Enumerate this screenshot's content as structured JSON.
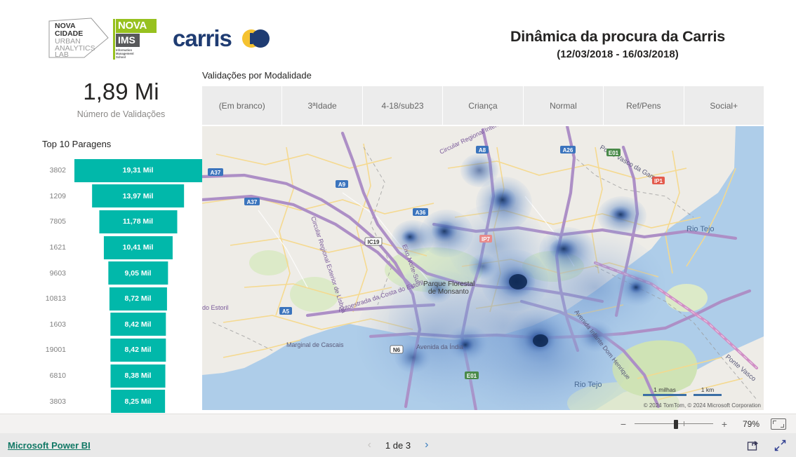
{
  "header": {
    "title": "Dinâmica da procura da Carris",
    "subtitle": "(12/03/2018 - 16/03/2018)",
    "logos": {
      "nova_cidade": [
        "NOVA",
        "CIDADE",
        "URBAN",
        "ANALYTICS",
        "LAB"
      ],
      "nova_ims_top": "NOVA",
      "nova_ims_mid": "IMS",
      "nova_ims_sub": [
        "Information",
        "Management",
        "School"
      ],
      "carris_word": "carris"
    }
  },
  "kpi": {
    "value": "1,89 Mi",
    "label": "Número de Validações"
  },
  "slicer": {
    "title": "Validações por Modalidade",
    "items": [
      {
        "label": "(Em branco)"
      },
      {
        "label": "3ªIdade"
      },
      {
        "label": "4-18/sub23"
      },
      {
        "label": "Criança"
      },
      {
        "label": "Normal"
      },
      {
        "label": "Ref/Pens"
      },
      {
        "label": "Social+"
      }
    ]
  },
  "chart_data": {
    "type": "bar",
    "title": "Top 10 Paragens",
    "xlabel": "",
    "ylabel": "Número de Validações",
    "orientation": "horizontal-centered",
    "bar_color": "#01B8AA",
    "categories": [
      "3802",
      "1209",
      "7805",
      "1621",
      "9603",
      "10813",
      "1603",
      "19001",
      "6810",
      "3803"
    ],
    "values": [
      19310,
      13970,
      11780,
      10410,
      9050,
      8720,
      8420,
      8420,
      8380,
      8250
    ],
    "labels": [
      "19,31 Mil",
      "13,97 Mil",
      "11,78 Mil",
      "10,41 Mil",
      "9,05 Mil",
      "8,72 Mil",
      "8,42 Mil",
      "8,42 Mil",
      "8,38 Mil",
      "8,25 Mil"
    ],
    "xlim": [
      0,
      19310
    ],
    "grid": false,
    "legend": "none"
  },
  "map": {
    "attribution": "© 2024 TomTom, © 2024 Microsoft Corporation",
    "scale_miles": "1 milhas",
    "scale_km": "1 km",
    "water_labels": [
      "Rio Tejo",
      "Rio Tejo"
    ],
    "place_labels": [
      "Parque Florestal de Monsanto"
    ],
    "road_labels": [
      "Ponte Vasco da Gama",
      "Ponte Vasco da Gama",
      "Circular Regional Interior de Lisboa",
      "Circular Regional Exterior de Lisboa",
      "Autoestrada da Costa do Estoril",
      "Autoestrada da Costa do Estoril",
      "Marginal de Cascais",
      "Avenida da Índia",
      "Avenida Infante Dom Henrique",
      "Eixo Norte-Sul"
    ],
    "shields": [
      "A37",
      "A37",
      "A9",
      "A8",
      "A26",
      "IC19",
      "A5",
      "N6",
      "E01",
      "E01",
      "IP7",
      "IP1"
    ],
    "heat_color_light": "#6f9fd8",
    "heat_color_dark": "#14315f"
  },
  "zoombar": {
    "minus": "−",
    "plus": "+",
    "percent": "79%",
    "fit_title": "Ajustar à página"
  },
  "footer": {
    "brand_link": "Microsoft Power BI",
    "prev": "‹",
    "next": "›",
    "page_label": "1 de 3",
    "share_icon": "share-icon",
    "fullscreen_icon": "fullscreen-icon"
  }
}
